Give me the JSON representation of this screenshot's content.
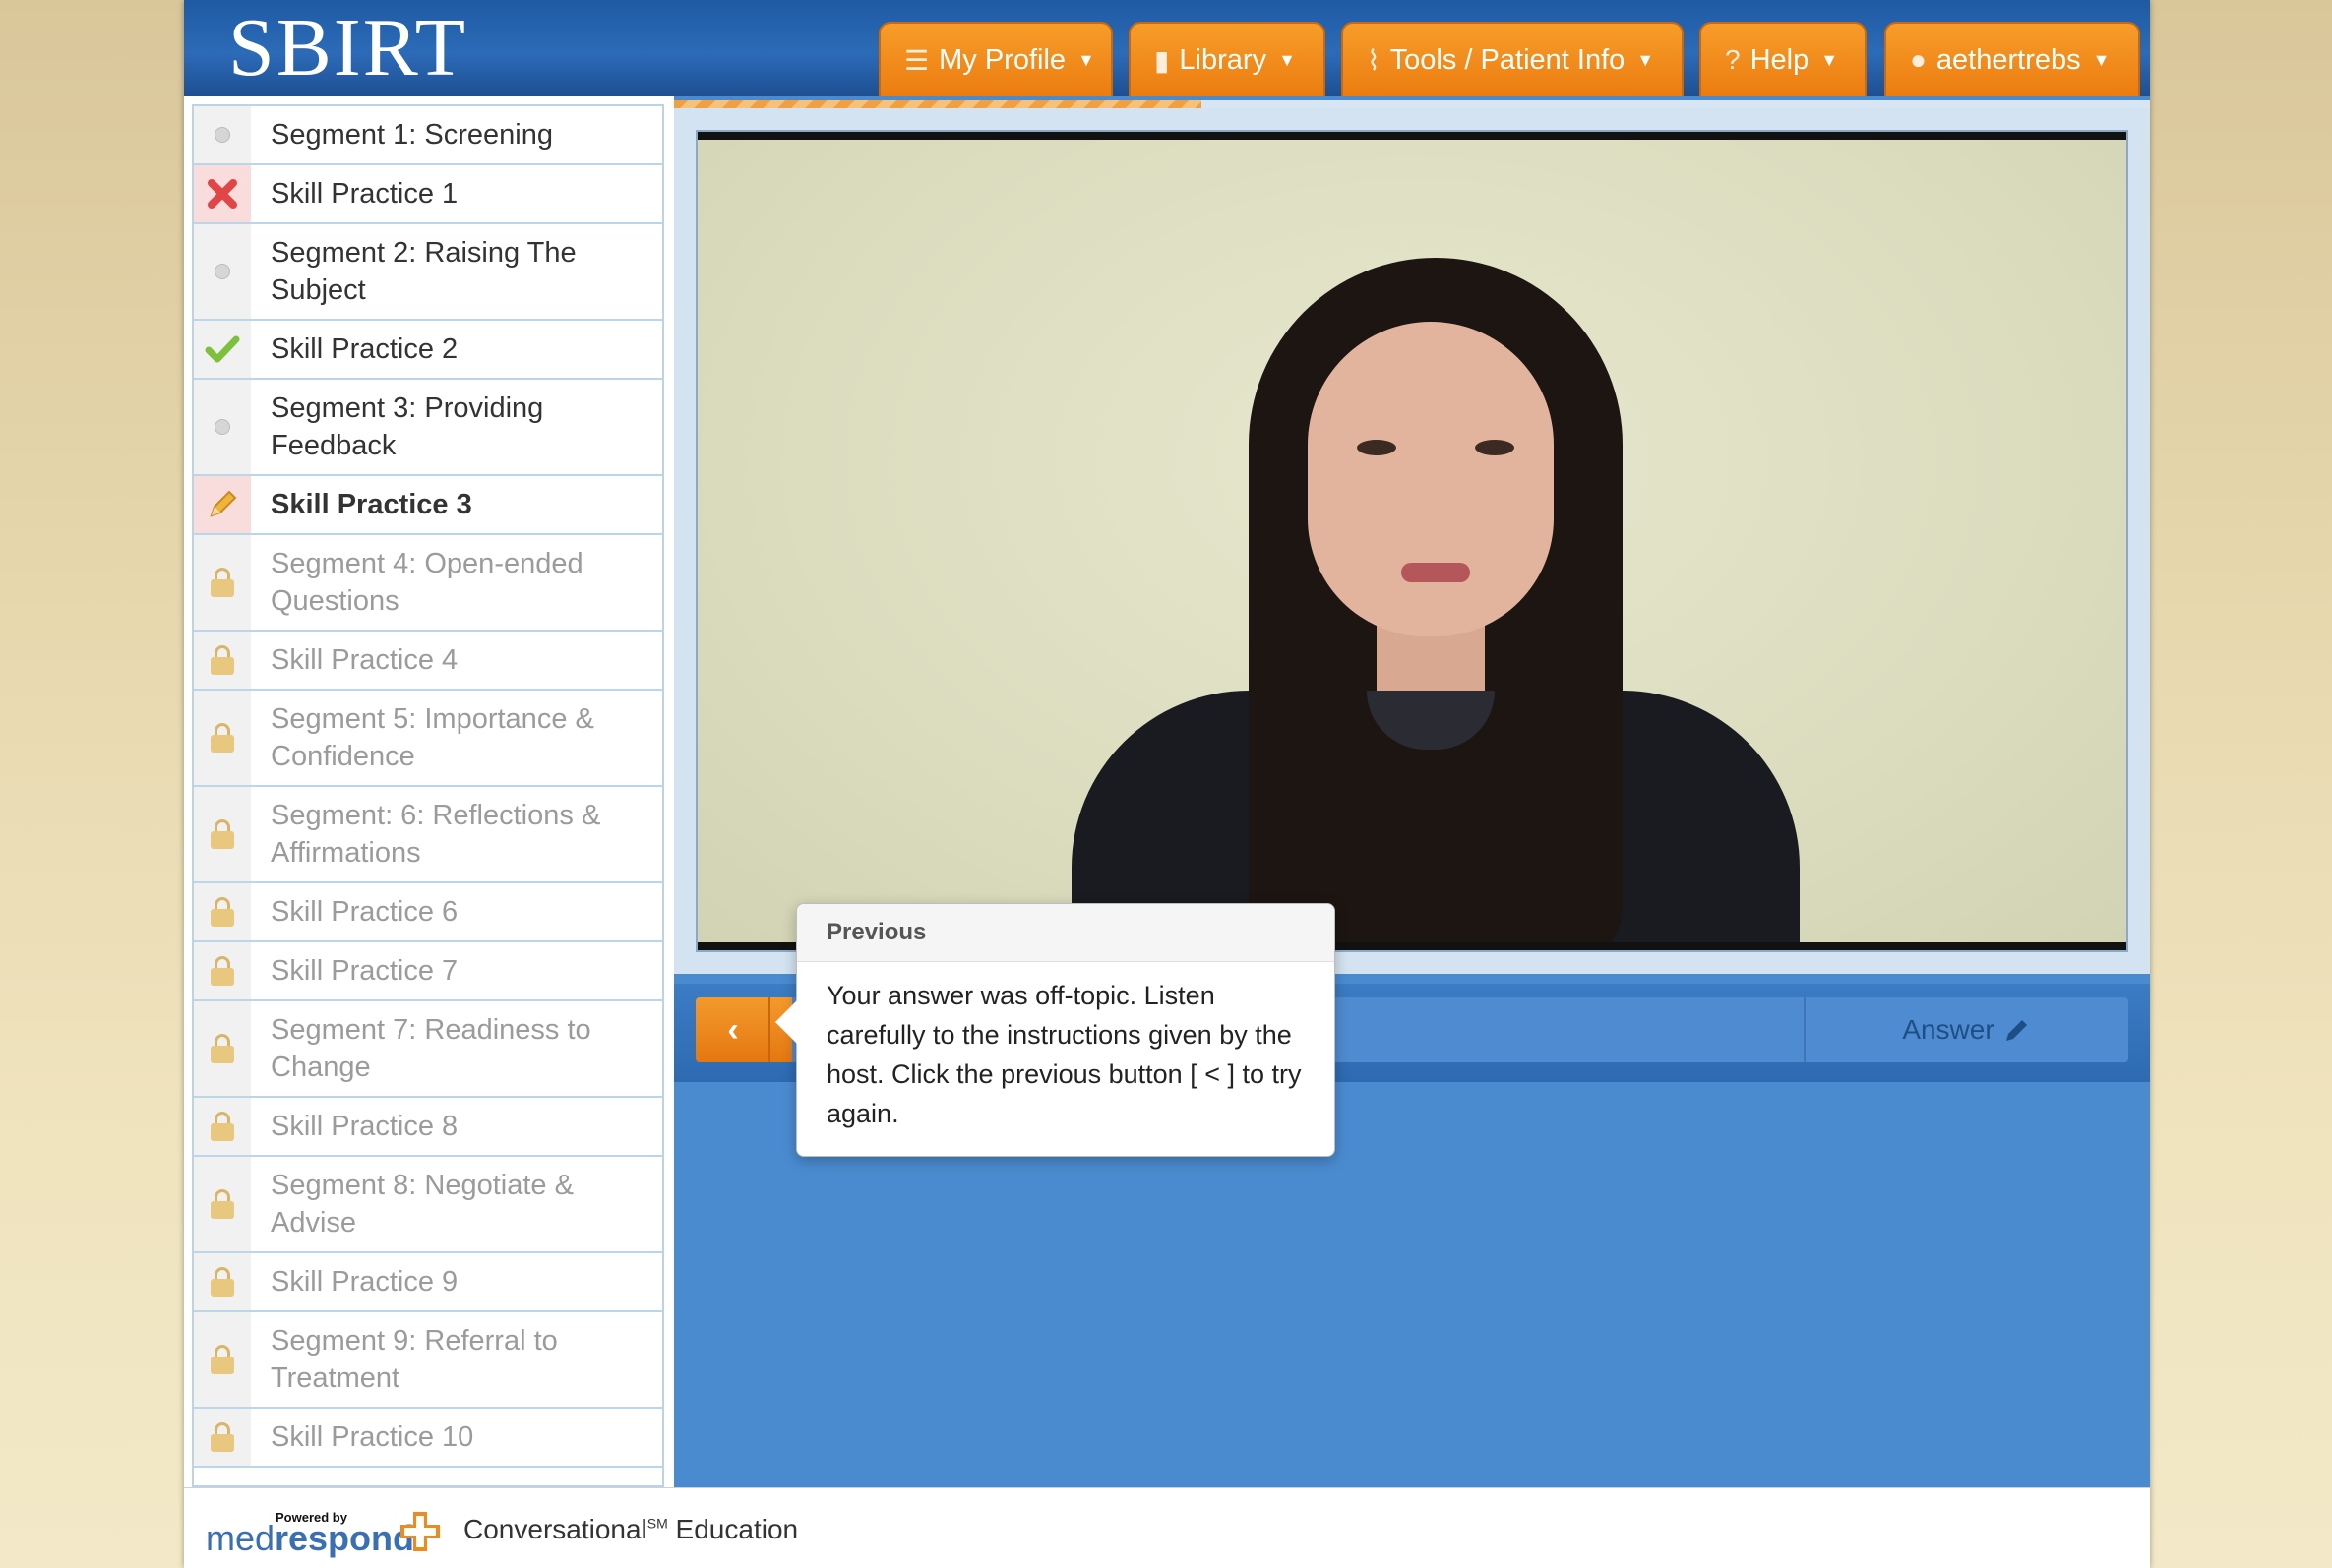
{
  "header": {
    "logo": "SBIRT",
    "nav": [
      {
        "label": "My Profile",
        "icon": "list-icon"
      },
      {
        "label": "Library",
        "icon": "book-icon"
      },
      {
        "label": "Tools / Patient Info",
        "icon": "paperclip-icon"
      },
      {
        "label": "Help",
        "icon": "help-icon"
      },
      {
        "label": "aethertrebs",
        "icon": "user-icon"
      }
    ]
  },
  "sidebar": {
    "items": [
      {
        "label": "Segment 1: Screening",
        "status": "complete"
      },
      {
        "label": "Skill Practice 1",
        "status": "failed"
      },
      {
        "label": "Segment 2: Raising The Subject",
        "status": "complete"
      },
      {
        "label": "Skill Practice 2",
        "status": "passed"
      },
      {
        "label": "Segment 3: Providing Feedback",
        "status": "complete"
      },
      {
        "label": "Skill Practice 3",
        "status": "in-progress"
      },
      {
        "label": "Segment 4: Open-ended Questions",
        "status": "locked"
      },
      {
        "label": "Skill Practice 4",
        "status": "locked"
      },
      {
        "label": "Segment 5: Importance & Confidence",
        "status": "locked"
      },
      {
        "label": "Segment: 6: Reflections & Affirmations",
        "status": "locked"
      },
      {
        "label": "Skill Practice 6",
        "status": "locked"
      },
      {
        "label": "Skill Practice 7",
        "status": "locked"
      },
      {
        "label": "Segment 7: Readiness to Change",
        "status": "locked"
      },
      {
        "label": "Skill Practice 8",
        "status": "locked"
      },
      {
        "label": "Segment 8: Negotiate & Advise",
        "status": "locked"
      },
      {
        "label": "Skill Practice 9",
        "status": "locked"
      },
      {
        "label": "Segment 9: Referral to Treatment",
        "status": "locked"
      },
      {
        "label": "Skill Practice 10",
        "status": "locked"
      }
    ]
  },
  "controls": {
    "prev_icon": "chevron-left-icon",
    "prev_glyph": "‹",
    "answer_label": "Answer",
    "answer_icon": "pencil-icon"
  },
  "popover": {
    "title": "Previous",
    "body": "Your answer was off-topic. Listen carefully to the instructions given by the host. Click the previous button [ < ] to try again."
  },
  "footer": {
    "powered_by": "Powered by",
    "brand_prefix": "med",
    "brand_suffix": "respond",
    "tagline": "Conversational",
    "tagline_mark": "SM",
    "tagline_suffix": " Education"
  },
  "colors": {
    "header_blue": "#2c6bb8",
    "nav_orange": "#ec7c10",
    "main_blue": "#4a8bd0",
    "failed_red": "#e04646",
    "passed_green": "#7cc03c"
  }
}
